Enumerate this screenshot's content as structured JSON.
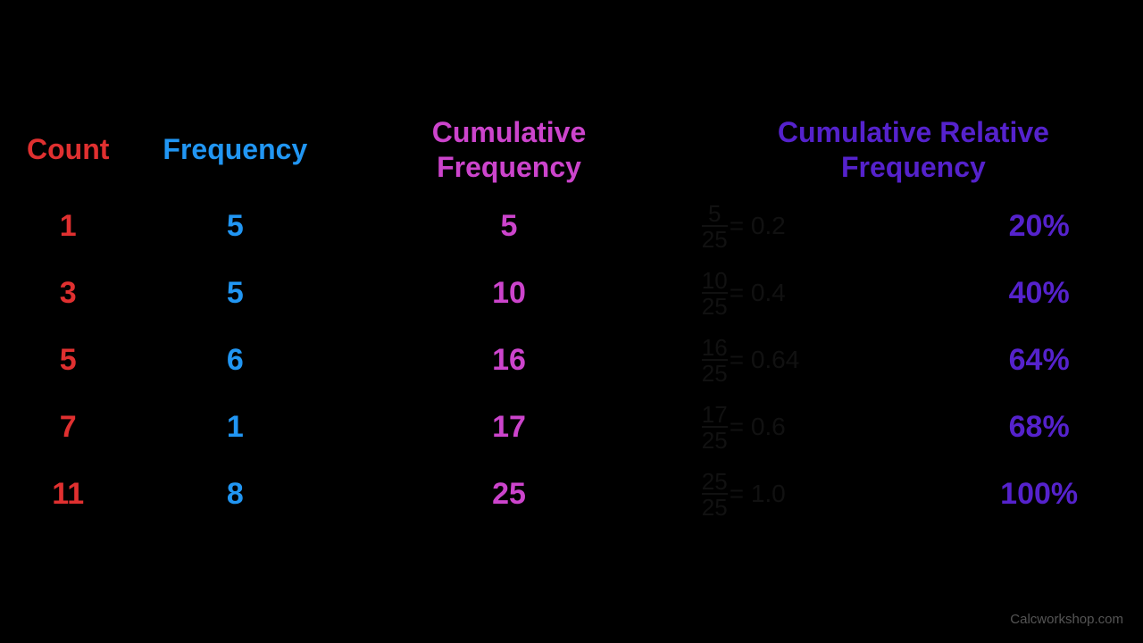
{
  "headers": {
    "count": "Count",
    "frequency": "Frequency",
    "cumulative_frequency": "Cumulative Frequency",
    "cumulative_relative_frequency": "Cumulative Relative Frequency"
  },
  "rows": [
    {
      "count": "1",
      "frequency": "5",
      "cum_freq": "5",
      "frac_num": "5",
      "frac_den": "25",
      "decimal": "= 0.2",
      "percent": "20%"
    },
    {
      "count": "3",
      "frequency": "5",
      "cum_freq": "10",
      "frac_num": "10",
      "frac_den": "25",
      "decimal": "= 0.4",
      "percent": "40%"
    },
    {
      "count": "5",
      "frequency": "6",
      "cum_freq": "16",
      "frac_num": "16",
      "frac_den": "25",
      "decimal": "= 0.64",
      "percent": "64%"
    },
    {
      "count": "7",
      "frequency": "1",
      "cum_freq": "17",
      "frac_num": "17",
      "frac_den": "25",
      "decimal": "= 0.6",
      "percent": "68%"
    },
    {
      "count": "11",
      "frequency": "8",
      "cum_freq": "25",
      "frac_num": "25",
      "frac_den": "25",
      "decimal": "= 1.0",
      "percent": "100%"
    }
  ],
  "watermark": "Calcworkshop.com"
}
